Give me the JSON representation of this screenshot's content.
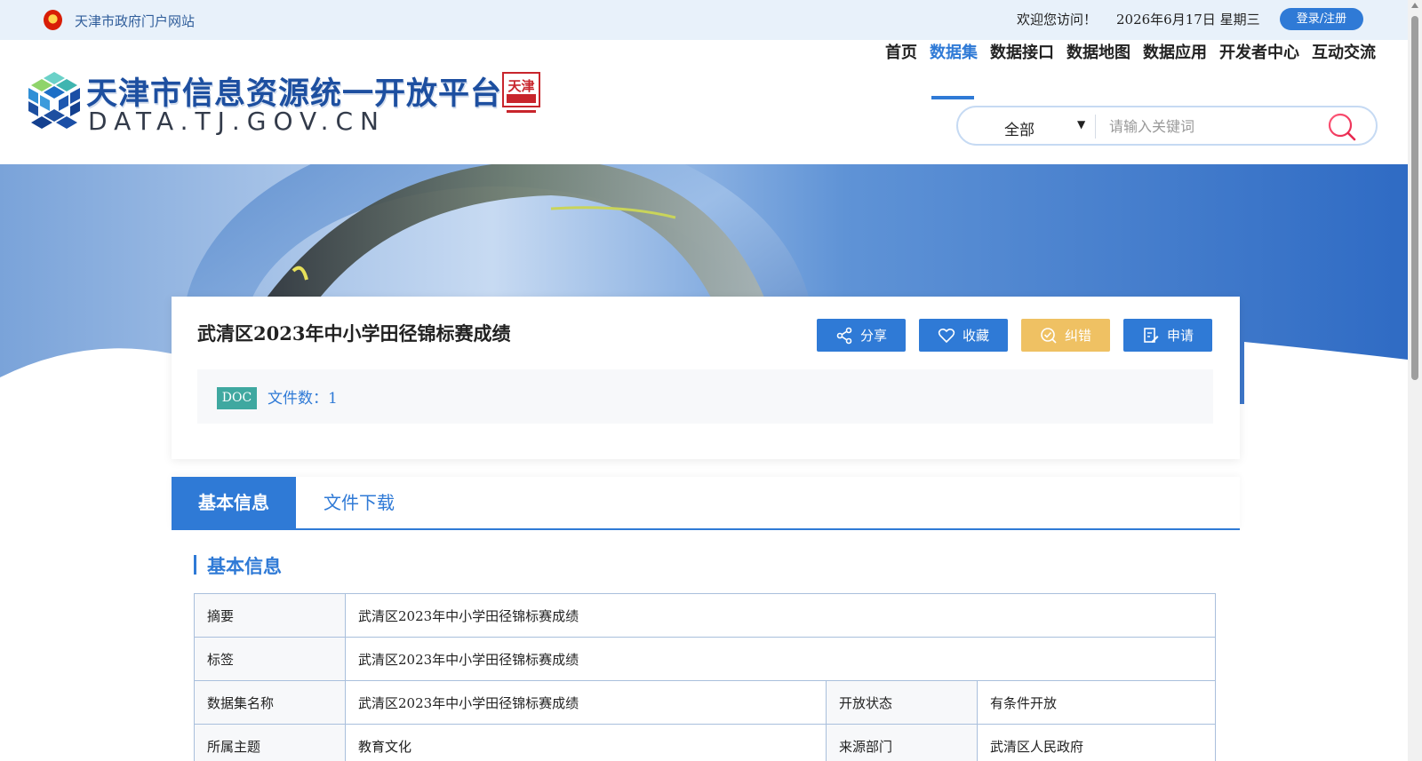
{
  "topbar": {
    "portal_link": "天津市政府门户网站",
    "welcome": "欢迎您访问！",
    "date": "2026年6月17日  星期三",
    "login_label": "登录/注册"
  },
  "header": {
    "logo_title": "天津市信息资源统一开放平台",
    "logo_domain": "DATA.TJ.GOV.CN",
    "seal_text": "天津",
    "nav": [
      "首页",
      "数据集",
      "数据接口",
      "数据地图",
      "数据应用",
      "开发者中心",
      "互动交流"
    ],
    "active_nav": "数据集",
    "search": {
      "scope": "全部",
      "placeholder": "请输入关键词"
    }
  },
  "dataset": {
    "title": "武清区2023年中小学田径锦标赛成绩",
    "actions": {
      "share": "分享",
      "favorite": "收藏",
      "correct": "纠错",
      "apply": "申请"
    },
    "file_type": "DOC",
    "file_count": "文件数：1"
  },
  "tabs": [
    "基本信息",
    "文件下载"
  ],
  "basic_info": {
    "section_title": "基本信息",
    "abstract_label": "摘要",
    "abstract": "武清区2023年中小学田径锦标赛成绩",
    "tags_label": "标签",
    "tags": "武清区2023年中小学田径锦标赛成绩",
    "name_label": "数据集名称",
    "name": "武清区2023年中小学田径锦标赛成绩",
    "open_status_label": "开放状态",
    "open_status": "有条件开放",
    "topic_label": "所属主题",
    "topic": "教育文化",
    "source_label": "来源部门",
    "source": "武清区人民政府"
  },
  "colors": {
    "primary": "#2f7ad6",
    "warning": "#efc163",
    "doc_badge": "#3fa8a0",
    "topbar_bg": "#e8f1fa"
  },
  "icons": {
    "emblem": "national-emblem-icon",
    "search": "search-icon",
    "share": "share-icon",
    "favorite": "heart-icon",
    "correct": "error-correct-icon",
    "apply": "apply-form-icon"
  }
}
